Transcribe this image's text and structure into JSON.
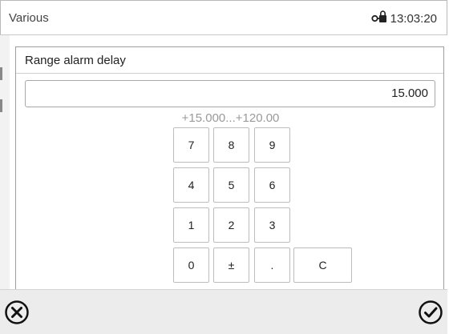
{
  "topbar": {
    "title": "Various",
    "time": "13:03:20",
    "lock_icon": "lock-key-icon"
  },
  "dialog": {
    "title": "Range alarm delay",
    "value": "15.000",
    "range_hint": "+15.000...+120.00"
  },
  "keypad": {
    "keys": [
      "7",
      "8",
      "9",
      "4",
      "5",
      "6",
      "1",
      "2",
      "3",
      "0",
      "±",
      ".",
      "C"
    ]
  },
  "footer": {
    "cancel_icon": "cancel-circle-icon",
    "confirm_icon": "confirm-check-icon"
  }
}
